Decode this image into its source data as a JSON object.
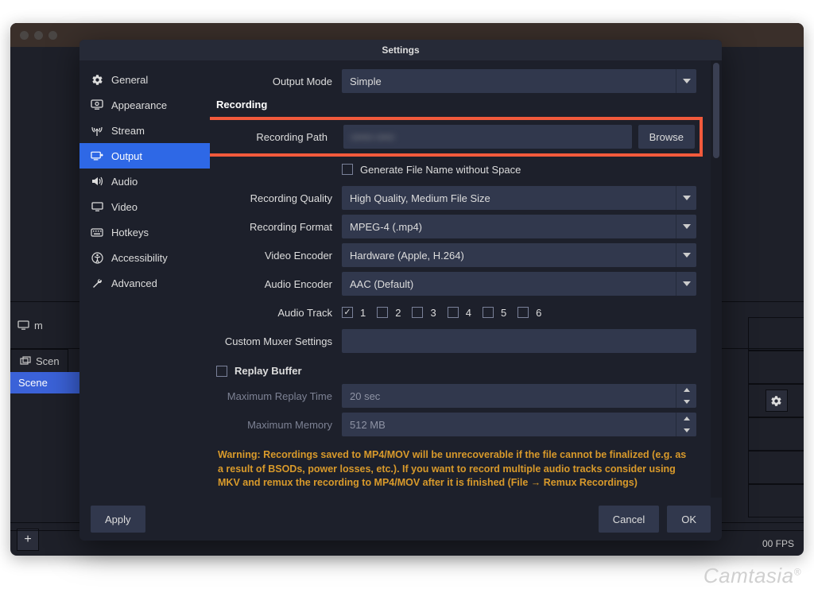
{
  "bg": {
    "panel_m_label": "m",
    "tab_scene": "Scen",
    "selected_scene": "Scene",
    "status_fps": "00 FPS"
  },
  "dialog": {
    "title": "Settings",
    "sidebar": {
      "items": [
        {
          "label": "General"
        },
        {
          "label": "Appearance"
        },
        {
          "label": "Stream"
        },
        {
          "label": "Output"
        },
        {
          "label": "Audio"
        },
        {
          "label": "Video"
        },
        {
          "label": "Hotkeys"
        },
        {
          "label": "Accessibility"
        },
        {
          "label": "Advanced"
        }
      ]
    },
    "form": {
      "output_mode_label": "Output Mode",
      "output_mode_value": "Simple",
      "recording_header": "Recording",
      "recording_path_label": "Recording Path",
      "recording_path_value": "•••••• •••••",
      "browse_label": "Browse",
      "gen_no_space_label": "Generate File Name without Space",
      "quality_label": "Recording Quality",
      "quality_value": "High Quality, Medium File Size",
      "format_label": "Recording Format",
      "format_value": "MPEG-4 (.mp4)",
      "vencoder_label": "Video Encoder",
      "vencoder_value": "Hardware (Apple, H.264)",
      "aencoder_label": "Audio Encoder",
      "aencoder_value": "AAC (Default)",
      "audio_track_label": "Audio Track",
      "tracks": [
        "1",
        "2",
        "3",
        "4",
        "5",
        "6"
      ],
      "muxer_label": "Custom Muxer Settings",
      "replay_buffer_label": "Replay Buffer",
      "replay_time_label": "Maximum Replay Time",
      "replay_time_value": "20 sec",
      "replay_mem_label": "Maximum Memory",
      "replay_mem_value": "512 MB",
      "warning": "Warning: Recordings saved to MP4/MOV will be unrecoverable if the file cannot be finalized (e.g. as a result of BSODs, power losses, etc.). If you want to record multiple audio tracks consider using MKV and remux the recording to MP4/MOV after it is finished (File → Remux Recordings)"
    },
    "buttons": {
      "apply": "Apply",
      "cancel": "Cancel",
      "ok": "OK"
    }
  },
  "watermark": "Camtasia"
}
